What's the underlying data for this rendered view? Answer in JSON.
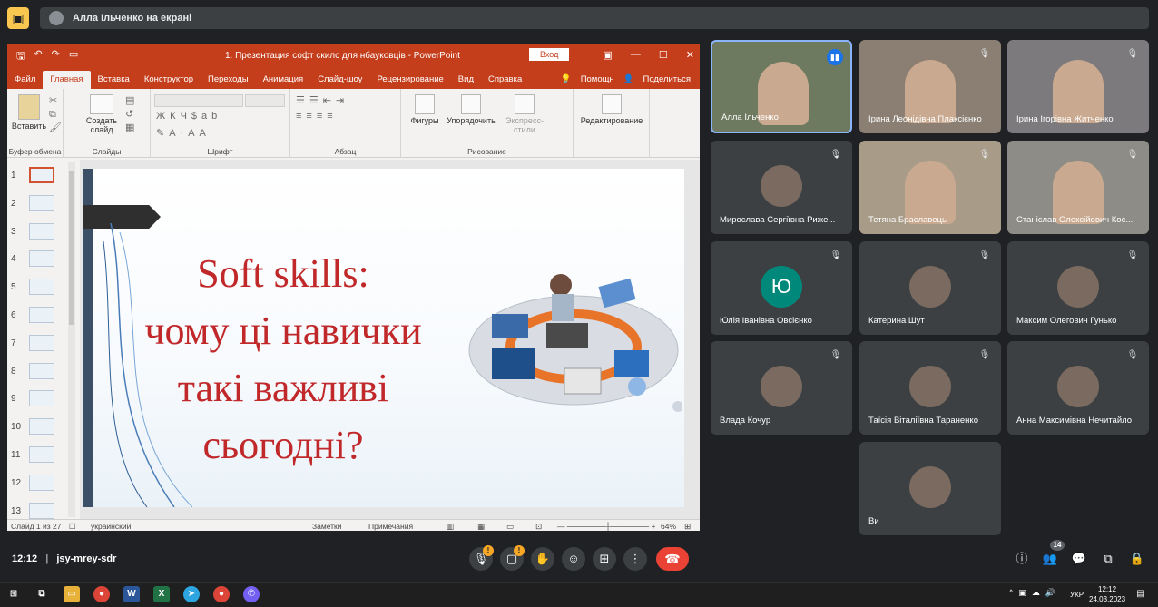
{
  "topbar": {
    "presenter_label": "Алла Ільченко на екрані"
  },
  "ppt": {
    "doc_title": "1. Презентация софт скилс для нбауковців  -  PowerPoint",
    "login": "Вход",
    "tabs": [
      "Файл",
      "Главная",
      "Вставка",
      "Конструктор",
      "Переходы",
      "Анимация",
      "Слайд-шоу",
      "Рецензирование",
      "Вид",
      "Справка"
    ],
    "tab_help": "Помощн",
    "tab_share": "Поделиться",
    "ribbon": {
      "paste": "Вставить",
      "clipboard": "Буфер обмена",
      "new_slide": "Создать слайд",
      "slides": "Слайды",
      "font": "Шрифт",
      "paragraph": "Абзац",
      "shapes": "Фигуры",
      "arrange": "Упорядочить",
      "quick_styles": "Экспресс-стили",
      "drawing": "Рисование",
      "editing": "Редактирование"
    },
    "thumb_numbers": [
      "1",
      "2",
      "3",
      "4",
      "5",
      "6",
      "7",
      "8",
      "9",
      "10",
      "11",
      "12",
      "13"
    ],
    "slide": {
      "line1": "Soft skills:",
      "line2": "чому ці навички",
      "line3": "такі важливі",
      "line4": "сьогодні?"
    },
    "status": {
      "slide_of": "Слайд 1 из 27",
      "lang": "украинский",
      "notes": "Заметки",
      "comments": "Примечания",
      "zoom": "64%"
    }
  },
  "participants": [
    {
      "name": "Алла Ільченко",
      "type": "video"
    },
    {
      "name": "Ірина Леонідівна Плаксієнко",
      "type": "video"
    },
    {
      "name": "Ірина Ігорівна Житченко",
      "type": "video"
    },
    {
      "name": "Мирослава Сергіївна Риже...",
      "type": "avatar"
    },
    {
      "name": "Тетяна Браславець",
      "type": "video"
    },
    {
      "name": "Станіслав Олексійович Кос...",
      "type": "video"
    },
    {
      "name": "Юлія Іванівна Овсієнко",
      "type": "initial",
      "initial": "Ю"
    },
    {
      "name": "Катерина Шут",
      "type": "avatar"
    },
    {
      "name": "Максим Олегович Гунько",
      "type": "avatar"
    },
    {
      "name": "Влада Кочур",
      "type": "avatar"
    },
    {
      "name": "Таїсія Віталіївна Тараненко",
      "type": "avatar"
    },
    {
      "name": "Анна Максимівна Нечитайло",
      "type": "avatar"
    },
    {
      "name": "Ви",
      "type": "avatar"
    }
  ],
  "bottom": {
    "time": "12:12",
    "meeting_code": "jsy-mrey-sdr",
    "people_count": "14",
    "mic_badge": "!",
    "cam_badge": "!"
  },
  "taskbar": {
    "lang": "УКР",
    "time": "12:12",
    "date": "24.03.2023"
  },
  "colors": {
    "ppt_accent": "#c43e1c",
    "slide_title": "#c0282a",
    "end_call": "#ea4335"
  }
}
